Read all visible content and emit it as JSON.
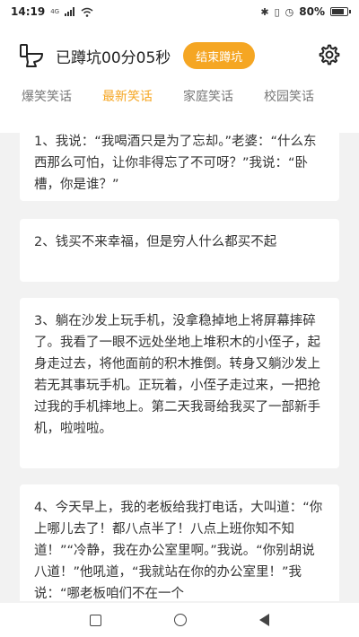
{
  "status_bar": {
    "time": "14:19",
    "network": "4G",
    "battery_text": "80%",
    "battery_level": 0.8
  },
  "header": {
    "timer": "已蹲坑00分05秒",
    "end_button": "结束蹲坑"
  },
  "tabs": [
    {
      "label": "爆笑笑话",
      "active": false
    },
    {
      "label": "最新笑话",
      "active": true
    },
    {
      "label": "家庭笑话",
      "active": false
    },
    {
      "label": "校园笑话",
      "active": false
    }
  ],
  "jokes": [
    {
      "text": "1、我说：“我喝酒只是为了忘却。”老婆：“什么东西那么可怕，让你非得忘了不可呀？”我说：“卧槽，你是谁？”"
    },
    {
      "text": "2、钱买不来幸福，但是穷人什么都买不起"
    },
    {
      "text": "3、躺在沙发上玩手机，没拿稳掉地上将屏幕摔碎了。我看了一眼不远处坐地上堆积木的小侄子，起身走过去，将他面前的积木推倒。转身又躺沙发上若无其事玩手机。正玩着，小侄子走过来，一把抢过我的手机摔地上。第二天我哥给我买了一部新手机，啦啦啦。"
    },
    {
      "text": "4、今天早上，我的老板给我打电话，大叫道：“你上哪儿去了！都八点半了！八点上班你知不知道！”“冷静，我在办公室里啊。”我说。“你别胡说八道！”他吼道，“我就站在你的办公室里！”我说：“哪老板咱们不在一个"
    }
  ],
  "colors": {
    "accent": "#f5a623",
    "background": "#f2f2f2",
    "card": "#ffffff"
  }
}
